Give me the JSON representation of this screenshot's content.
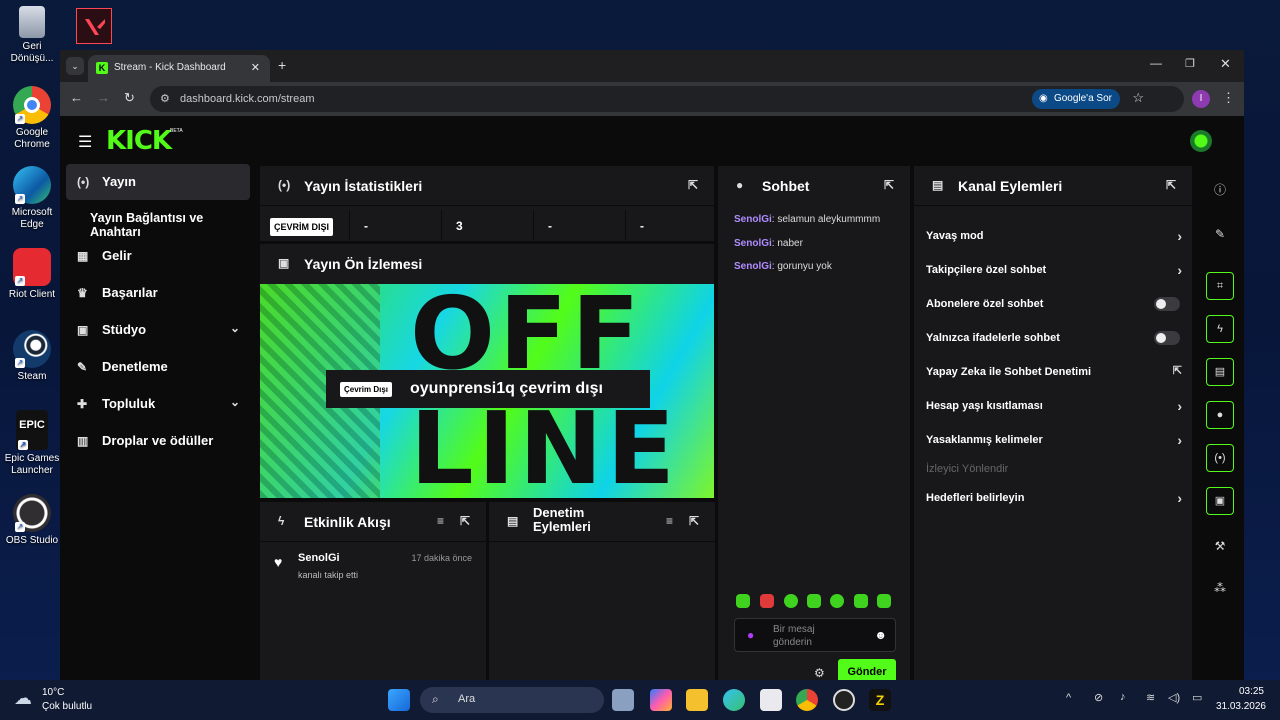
{
  "desktop": {
    "icons": [
      {
        "label": "Geri Dönüşü...",
        "icon": "recycle-bin-icon"
      },
      {
        "label": "Google Chrome",
        "icon": "chrome-icon"
      },
      {
        "label": "Microsoft Edge",
        "icon": "edge-icon"
      },
      {
        "label": "Riot Client",
        "icon": "riot-icon"
      },
      {
        "label": "Steam",
        "icon": "steam-icon"
      },
      {
        "label": "Epic Games Launcher",
        "icon": "epic-icon"
      },
      {
        "label": "OBS Studio",
        "icon": "obs-icon"
      }
    ],
    "valorant_icon": "valorant-icon"
  },
  "browser": {
    "tab_title": "Stream - Kick Dashboard",
    "url": "dashboard.kick.com/stream",
    "ask_button": "Google'a Sor",
    "profile_initial": "I"
  },
  "kick": {
    "logo": "KICK",
    "beta": "BETA",
    "accent": "#53fc18",
    "nav": [
      {
        "label": "Yayın",
        "icon": "broadcast-icon",
        "active": true
      },
      {
        "label": "Yayın Bağlantısı ve Anahtarı",
        "icon": ""
      },
      {
        "label": "Gelir",
        "icon": "revenue-icon"
      },
      {
        "label": "Başarılar",
        "icon": "trophy-icon"
      },
      {
        "label": "Stüdyo",
        "icon": "studio-icon",
        "expandable": true
      },
      {
        "label": "Denetleme",
        "icon": "moderation-icon"
      },
      {
        "label": "Topluluk",
        "icon": "community-icon",
        "expandable": true
      },
      {
        "label": "Droplar ve ödüller",
        "icon": "drops-icon"
      }
    ],
    "stats_panel": {
      "title": "Yayın İstatistikleri",
      "offline_badge": "ÇEVRİM DIŞI",
      "values": [
        "-",
        "3",
        "-",
        "-"
      ]
    },
    "preview_panel": {
      "title": "Yayın Ön İzlemesi",
      "offline_badge": "Çevrim Dışı",
      "offline_text": "oyunprensi1q çevrim dışı",
      "bg_word_1": "OFF",
      "bg_word_2": "LINE"
    },
    "activity_panel": {
      "title": "Etkinlik Akışı",
      "items": [
        {
          "user": "SenolGi",
          "text": "kanalı takip etti",
          "time": "17 dakika önce"
        }
      ]
    },
    "mod_actions_panel": {
      "title": "Denetim Eylemleri"
    },
    "chat_panel": {
      "title": "Sohbet",
      "messages": [
        {
          "user": "SenolGi",
          "text": ": selamun aleykummmm"
        },
        {
          "user": "SenolGi",
          "text": ": naber"
        },
        {
          "user": "SenolGi",
          "text": ": gorunyu yok"
        }
      ],
      "input_placeholder": "Bir mesaj gönderin",
      "send_label": "Gönder"
    },
    "channel_actions": {
      "title": "Kanal Eylemleri",
      "items": [
        {
          "label": "Yavaş mod",
          "control": "arrow"
        },
        {
          "label": "Takipçilere özel sohbet",
          "control": "arrow"
        },
        {
          "label": "Abonelere özel sohbet",
          "control": "toggle",
          "on": false
        },
        {
          "label": "Yalnızca ifadelerle sohbet",
          "control": "toggle",
          "on": false
        },
        {
          "label": "Yapay Zeka ile Sohbet Denetimi",
          "control": "external"
        },
        {
          "label": "Hesap yaşı kısıtlaması",
          "control": "arrow"
        },
        {
          "label": "Yasaklanmış kelimeler",
          "control": "arrow"
        },
        {
          "label": "İzleyici Yönlendir",
          "control": "disabled"
        },
        {
          "label": "Hedefleri belirleyin",
          "control": "arrow"
        }
      ]
    }
  },
  "taskbar": {
    "weather_temp": "10°C",
    "weather_text": "Çok bulutlu",
    "search_placeholder": "Ara",
    "time": "03:25",
    "date": "31.03.2026"
  }
}
